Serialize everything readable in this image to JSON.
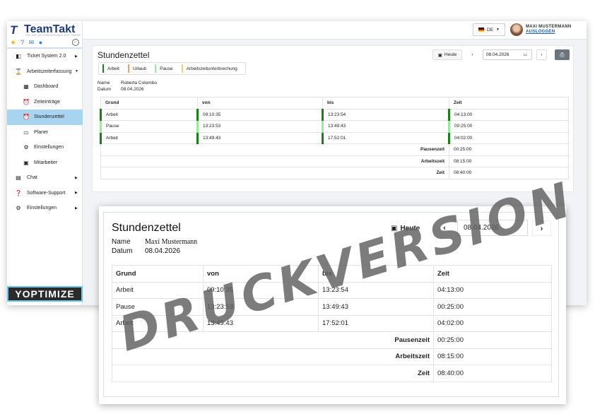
{
  "app": {
    "logo_mark": "T",
    "logo_text": "TeamTakt",
    "logo_subtext": "ONLINE ZEITERFASSUNG SOFTWARE",
    "vendor": "YOPTIMIZE"
  },
  "topbar": {
    "language": "DE",
    "user_name": "MAXI MUSTERMANN",
    "logout_label": "AUSLOGGEN"
  },
  "sidebar": {
    "items": [
      {
        "label": "Ticket System 2.0",
        "icon": "ticket-icon"
      },
      {
        "label": "Arbeitszeiterfassung",
        "icon": "hourglass-icon"
      },
      {
        "label": "Dashboard",
        "icon": "dashboard-icon"
      },
      {
        "label": "Zeiteinträge",
        "icon": "alarm-clock-icon"
      },
      {
        "label": "Stundenzettel",
        "icon": "alarm-clock-icon"
      },
      {
        "label": "Planer",
        "icon": "calendar-icon"
      },
      {
        "label": "Einstellungen",
        "icon": "gear-icon"
      },
      {
        "label": "Mitarbeiter",
        "icon": "person-icon"
      },
      {
        "label": "Chat",
        "icon": "chat-icon"
      },
      {
        "label": "Software-Support",
        "icon": "question-icon"
      },
      {
        "label": "Einstellungen",
        "icon": "gear-icon"
      }
    ]
  },
  "timesheet": {
    "title": "Stundenzettel",
    "today_label": "Heute",
    "date": "08.04.2026",
    "legend": [
      {
        "label": "Arbeit",
        "color": "#1a7f1a"
      },
      {
        "label": "Urlaub",
        "color": "#f0a060"
      },
      {
        "label": "Pause",
        "color": "#9ee89e"
      },
      {
        "label": "Arbeitszeitunterbrechung",
        "color": "#f3d070"
      }
    ],
    "name_label": "Name",
    "name_value": "Roberta Colombo",
    "date_label": "Datum",
    "date_value": "08.04.2026",
    "columns": [
      "Grund",
      "von",
      "bis",
      "Zeit"
    ],
    "rows": [
      {
        "grund": "Arbeit",
        "von": "09:10:35",
        "bis": "13:23:54",
        "zeit": "04:13:00",
        "color": "#1a7f1a"
      },
      {
        "grund": "Pause",
        "von": "13:23:53",
        "bis": "13:49:43",
        "zeit": "00:25:00",
        "color": "#9ee89e"
      },
      {
        "grund": "Arbeit",
        "von": "13:49:43",
        "bis": "17:52:01",
        "zeit": "04:02:00",
        "color": "#1a7f1a"
      }
    ],
    "summary": [
      {
        "label": "Pausenzeit",
        "value": "00:25:00"
      },
      {
        "label": "Arbeitszeit",
        "value": "08:15:00"
      },
      {
        "label": "Zeit",
        "value": "08:40:00"
      }
    ]
  },
  "print_version": {
    "title": "Stundenzettel",
    "today_label": "Heute",
    "date": "08.04.2026",
    "name_label": "Name",
    "name_value": "Maxi Mustermann",
    "date_label": "Datum",
    "date_value": "08.04.2026",
    "columns": [
      "Grund",
      "von",
      "bis",
      "Zeit"
    ],
    "rows": [
      {
        "grund": "Arbeit",
        "von": "09:10:35",
        "bis": "13:23:54",
        "zeit": "04:13:00"
      },
      {
        "grund": "Pause",
        "von": "13:23:53",
        "bis": "13:49:43",
        "zeit": "00:25:00"
      },
      {
        "grund": "Arbeit",
        "von": "13:49:43",
        "bis": "17:52:01",
        "zeit": "04:02:00"
      }
    ],
    "summary": [
      {
        "label": "Pausenzeit",
        "value": "00:25:00"
      },
      {
        "label": "Arbeitszeit",
        "value": "08:15:00"
      },
      {
        "label": "Zeit",
        "value": "08:40:00"
      }
    ],
    "watermark": "DRUCKVERSION"
  }
}
